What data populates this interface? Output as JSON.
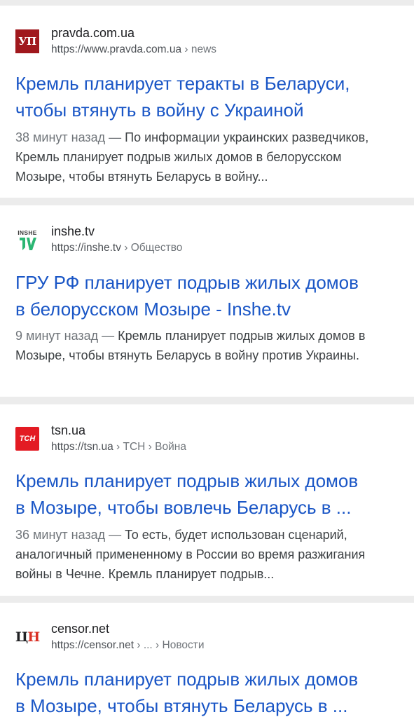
{
  "results": [
    {
      "favicon_icon": "ukrainska-pravda-logo",
      "favicon_text": "УП",
      "site_name": "pravda.com.ua",
      "url_base": "https://www.pravda.com.ua",
      "url_crumbs": " › news",
      "title_line1": "Кремль планирует теракты в Беларуси,",
      "title_line2": "чтобы втянуть в войну с Украиной",
      "age": "38 минут назад — ",
      "snippet": "По информации украинских разведчиков, Кремль планирует подрыв жилых домов в белорусском Мозыре, чтобы втянуть Беларусь в войну..."
    },
    {
      "favicon_icon": "inshe-tv-logo",
      "favicon_text": "INSHE",
      "site_name": "inshe.tv",
      "url_base": "https://inshe.tv",
      "url_crumbs": " › Общество",
      "title_line1": "ГРУ РФ планирует подрыв жилых домов",
      "title_line2": "в белорусском Мозыре - Inshe.tv",
      "age": "9 минут назад — ",
      "snippet": "Кремль планирует подрыв жилых домов в Мозыре, чтобы втянуть Беларусь в войну против Украины."
    },
    {
      "favicon_icon": "tsn-logo",
      "favicon_text": "ТСН",
      "site_name": "tsn.ua",
      "url_base": "https://tsn.ua",
      "url_crumbs": " › ТСН › Война",
      "title_line1": "Кремль планирует подрыв жилых домов",
      "title_line2": "в Мозыре, чтобы вовлечь Беларусь в ...",
      "age": "36 минут назад — ",
      "snippet": "То есть, будет использован сценарий, аналогичный примененному в России во время разжигания войны в Чечне. Кремль планирует подрыв..."
    },
    {
      "favicon_icon": "censor-net-logo",
      "favicon_text_1": "Ц",
      "favicon_text_2": "Н",
      "site_name": "censor.net",
      "url_base": "https://censor.net",
      "url_crumbs": " › ... › Новости",
      "title_line1": "Кремль планирует подрыв жилых домов",
      "title_line2": "в Мозыре, чтобы втянуть Беларусь в ..."
    }
  ],
  "colors": {
    "title_link": "#1a56c6",
    "page_background": "#ececec",
    "card_background": "#ffffff",
    "pravda_brand": "#a0181d",
    "tsn_brand": "#e31b23",
    "inshe_green": "#2bb673",
    "censor_red": "#d93025"
  }
}
